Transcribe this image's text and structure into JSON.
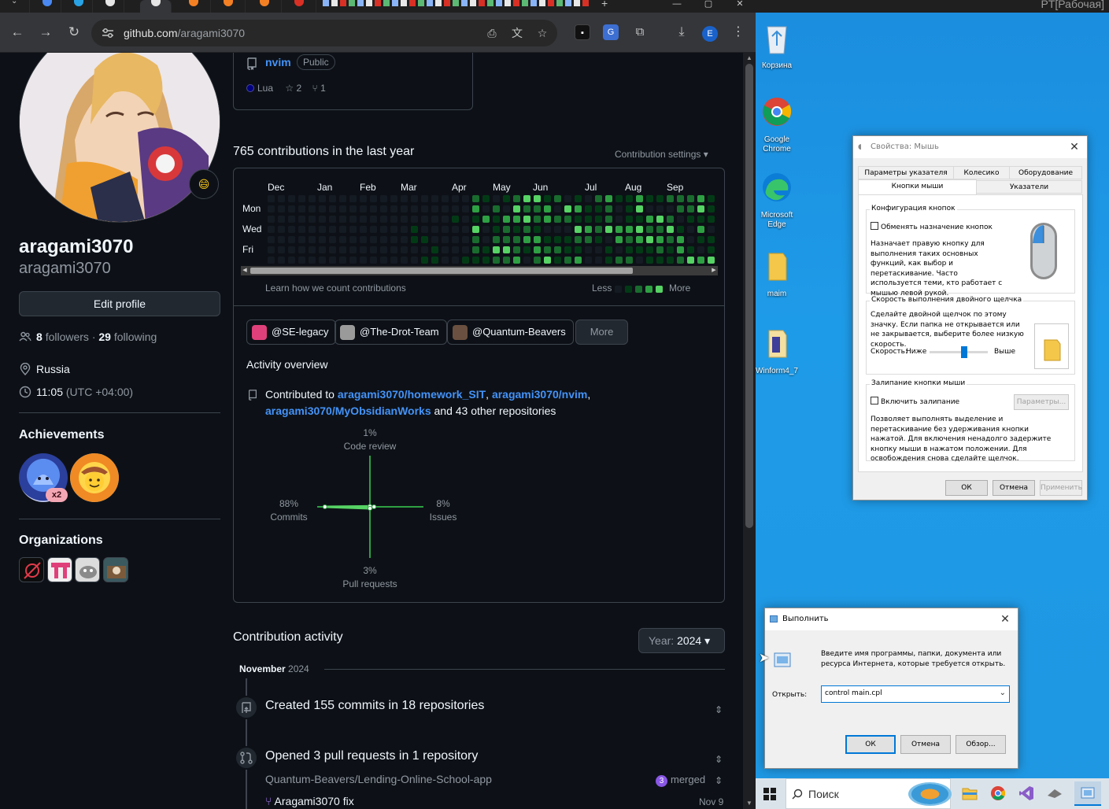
{
  "browser": {
    "url_host": "github.com",
    "url_path": "/aragami3070",
    "profile_initial": "E",
    "window_controls": [
      "—",
      "▢",
      "✕"
    ]
  },
  "profile": {
    "name": "aragami3070",
    "login": "aragami3070",
    "edit_button": "Edit profile",
    "followers_count": "8",
    "followers_label": "followers",
    "separator": "·",
    "following_count": "29",
    "following_label": "following",
    "location": "Russia",
    "time": "11:05",
    "timezone": "(UTC +04:00)",
    "status_emoji": "😄"
  },
  "achievements": {
    "title": "Achievements",
    "badge_multiplier": "x2"
  },
  "organizations": {
    "title": "Organizations"
  },
  "pinned_repo": {
    "name": "nvim",
    "visibility": "Public",
    "language": "Lua",
    "stars": "2",
    "forks": "1"
  },
  "contributions": {
    "heading": "765 contributions in the last year",
    "settings_label": "Contribution settings",
    "months": [
      "Dec",
      "Jan",
      "Feb",
      "Mar",
      "Apr",
      "May",
      "Jun",
      "Jul",
      "Aug",
      "Sep"
    ],
    "day_labels": [
      "Mon",
      "Wed",
      "Fri"
    ],
    "learn_link": "Learn how we count contributions",
    "legend_less": "Less",
    "legend_more": "More",
    "colors": [
      "#151b23",
      "#033a16",
      "#196c2e",
      "#2ea043",
      "#56d364"
    ]
  },
  "activity": {
    "orgs": [
      "@SE-legacy",
      "@The-Drot-Team",
      "@Quantum-Beavers"
    ],
    "more_button": "More",
    "overview_title": "Activity overview",
    "contributed_prefix": "Contributed to",
    "repos": [
      "aragami3070/homework_SIT",
      "aragami3070/nvim",
      "aragami3070/MyObsidianWorks"
    ],
    "comma": ",",
    "others": "and 43 other repositories",
    "code_review_pct": "1%",
    "code_review_label": "Code review",
    "commits_pct": "88%",
    "commits_label": "Commits",
    "issues_pct": "8%",
    "issues_label": "Issues",
    "pr_pct": "3%",
    "pr_label": "Pull requests"
  },
  "contribution_activity": {
    "title": "Contribution activity",
    "year_label": "Year:",
    "year_value": "2024",
    "month": "November",
    "month_year": "2024",
    "item1_title": "Created 155 commits in 18 repositories",
    "item2_title": "Opened 3 pull requests in 1 repository",
    "pr_repo": "Quantum-Beavers/Lending-Online-School-app",
    "merged_count": "3",
    "merged_label": "merged",
    "pr_title": "Aragami3070 fix",
    "pr_date": "Nov 9"
  },
  "desktop": {
    "rdp_title": "PT[Рабочая]",
    "icons": [
      "Корзина",
      "Google Chrome",
      "Microsoft Edge",
      "maim",
      "Winform4_7"
    ]
  },
  "mouse_props": {
    "title": "Свойства: Мышь",
    "tabs_row1": [
      "Параметры указателя",
      "Колесико",
      "Оборудование"
    ],
    "tabs_row2": [
      "Кнопки мыши",
      "Указатели"
    ],
    "config_group": "Конфигурация кнопок",
    "swap_label": "Обменять назначение кнопок",
    "swap_desc": "Назначает правую кнопку для выполнения таких основных функций, как выбор и перетаскивание. Часто используется теми, кто работает с мышью левой рукой.",
    "dblclick_group": "Скорость выполнения двойного щелчка",
    "dblclick_desc": "Сделайте двойной щелчок по этому значку. Если папка не открывается или не закрывается, выберите более низкую скорость.",
    "speed_label": "Скорость:",
    "speed_low": "Ниже",
    "speed_high": "Выше",
    "clicklock_group": "Залипание кнопки мыши",
    "clicklock_label": "Включить залипание",
    "params_button": "Параметры...",
    "clicklock_desc": "Позволяет выполнять выделение и перетаскивание без удерживания кнопки нажатой. Для включения ненадолго задержите кнопку мыши в нажатом положении. Для освобождения снова сделайте щелчок.",
    "ok": "ОК",
    "cancel": "Отмена",
    "apply": "Применить"
  },
  "run_dialog": {
    "title": "Выполнить",
    "desc": "Введите имя программы, папки, документа или ресурса Интернета, которые требуется открыть.",
    "open_label": "Открыть:",
    "open_value": "control main.cpl",
    "ok": "ОК",
    "cancel": "Отмена",
    "browse": "Обзор..."
  },
  "taskbar": {
    "search_placeholder": "Поиск"
  }
}
